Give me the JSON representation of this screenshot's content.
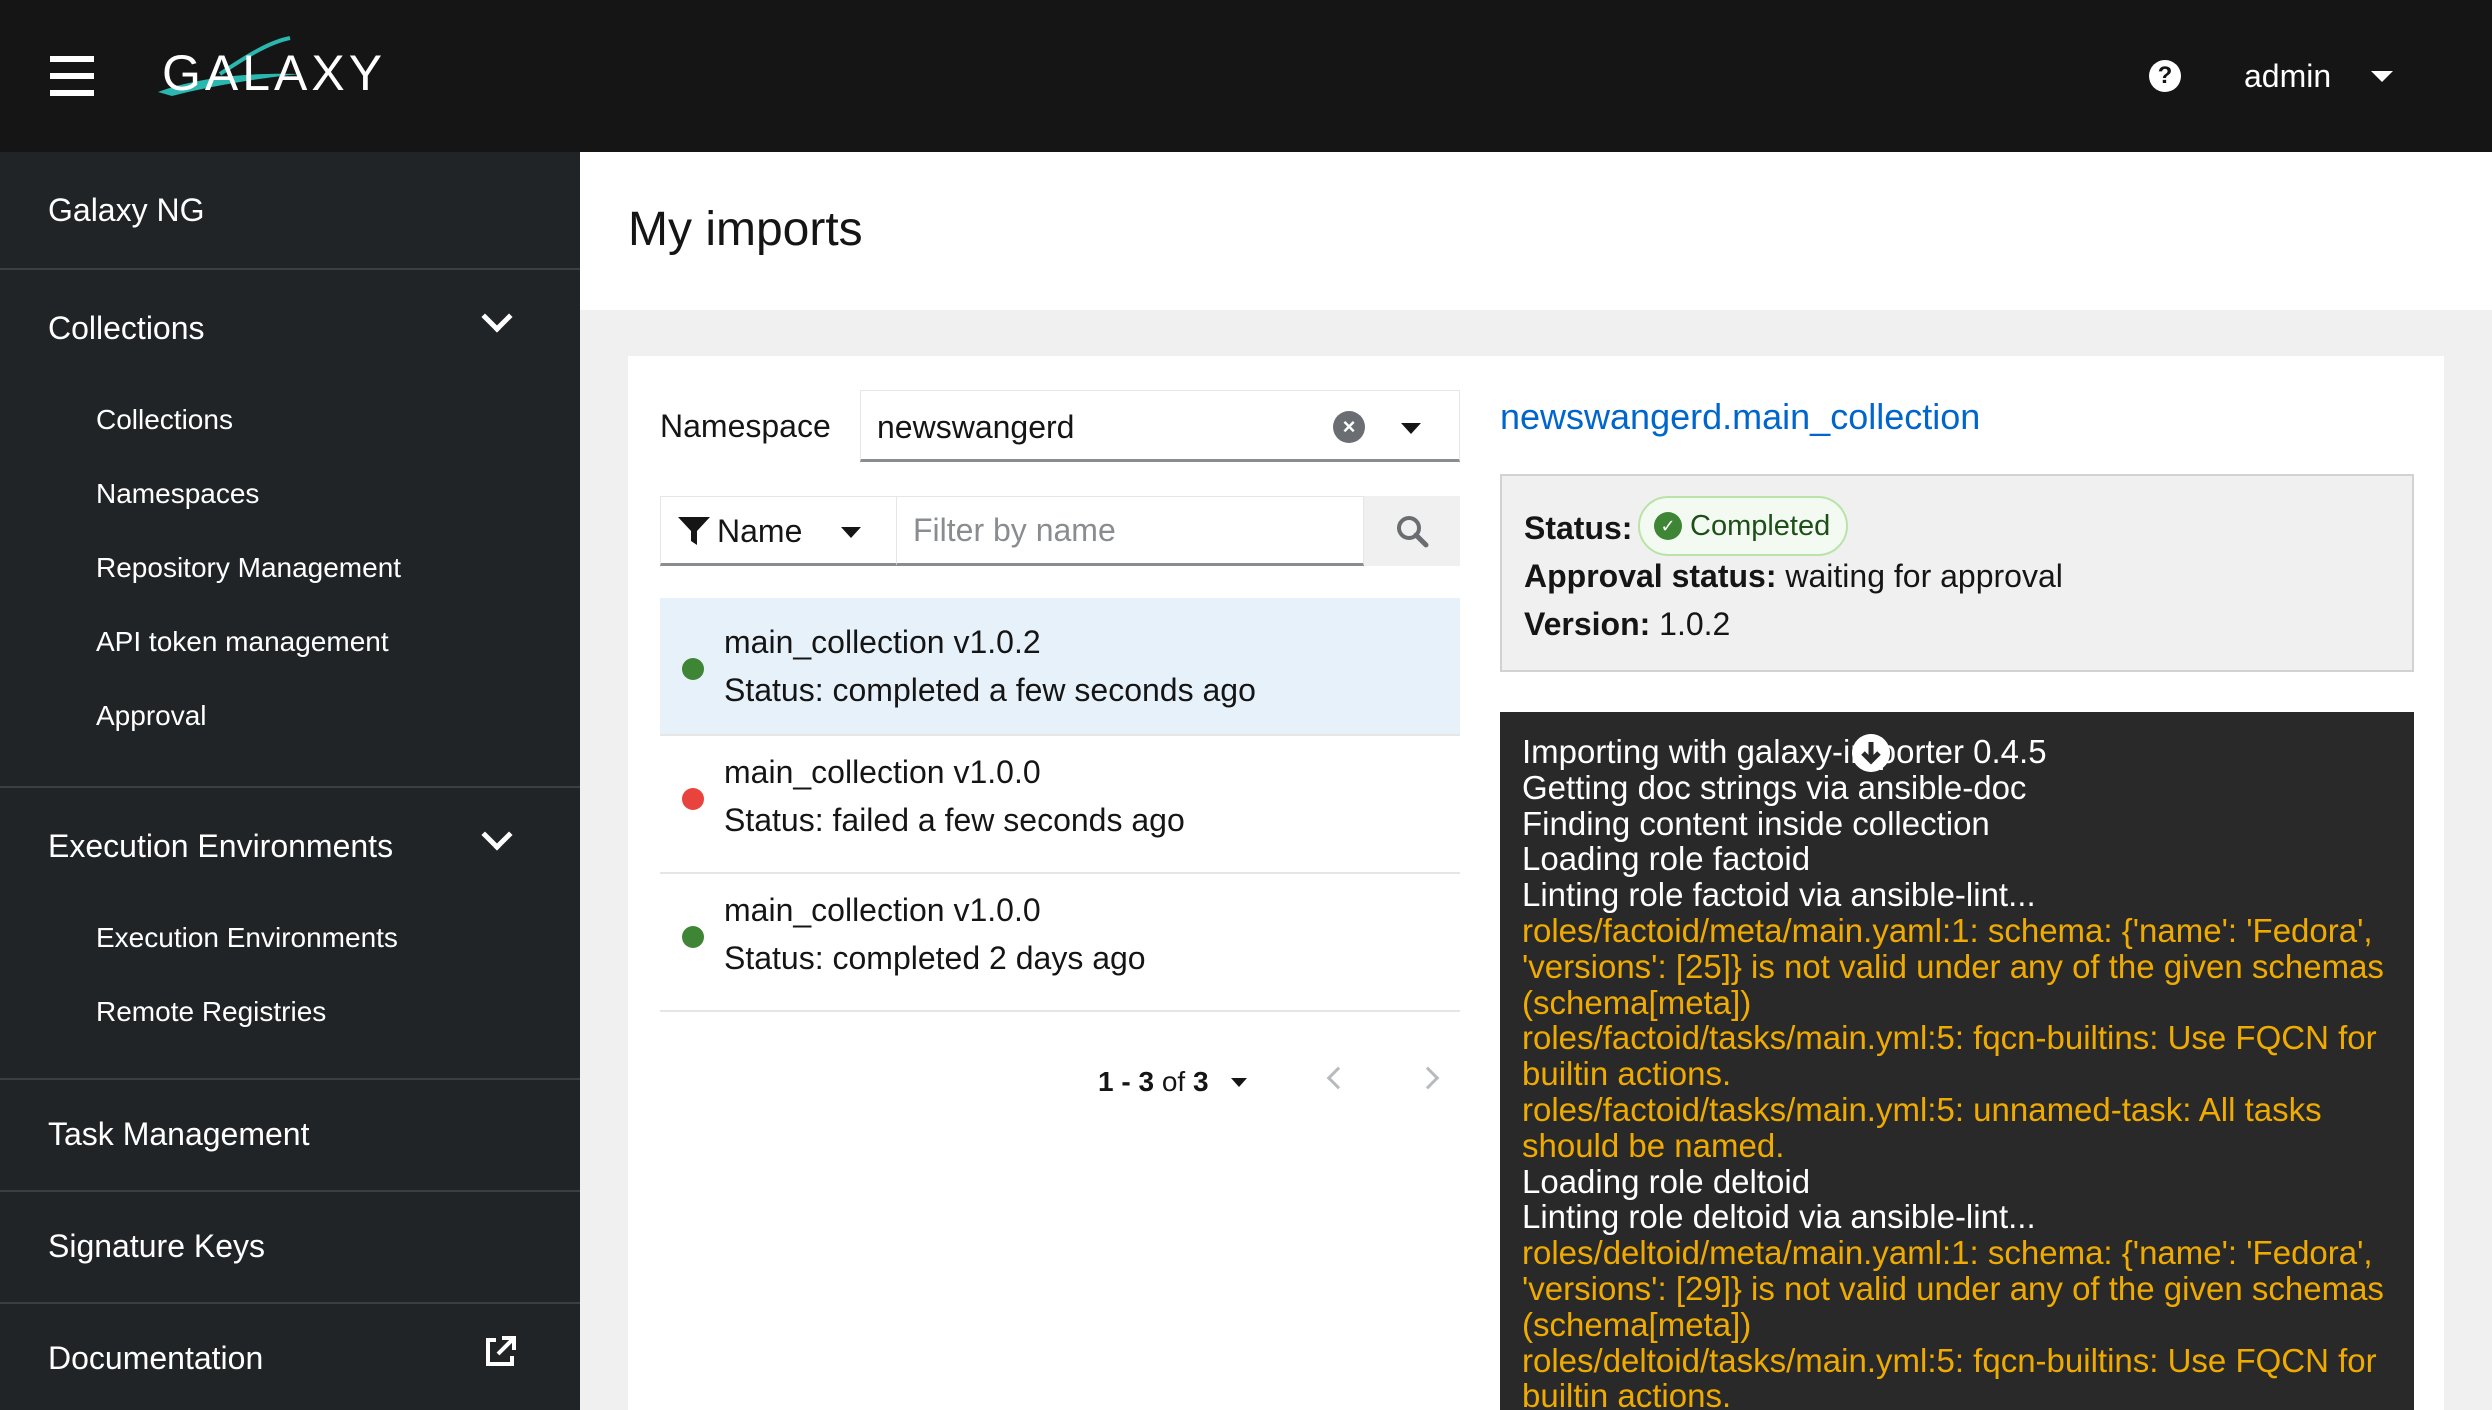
{
  "header": {
    "logo_text": "GALAXY",
    "user": "admin"
  },
  "sidebar": {
    "top_item": "Galaxy NG",
    "sections": [
      {
        "label": "Collections",
        "items": [
          "Collections",
          "Namespaces",
          "Repository Management",
          "API token management",
          "Approval"
        ]
      },
      {
        "label": "Execution Environments",
        "items": [
          "Execution Environments",
          "Remote Registries"
        ]
      }
    ],
    "task_management": "Task Management",
    "signature_keys": "Signature Keys",
    "documentation": "Documentation"
  },
  "page": {
    "title": "My imports"
  },
  "namespace_filter": {
    "label": "Namespace",
    "value": "newswangerd"
  },
  "filter": {
    "attribute": "Name",
    "placeholder": "Filter by name"
  },
  "imports": [
    {
      "name": "main_collection v1.0.2",
      "status": "Status: completed a few seconds ago",
      "state": "completed",
      "dot_color": "#3e8635",
      "selected": true
    },
    {
      "name": "main_collection v1.0.0",
      "status": "Status: failed a few seconds ago",
      "state": "failed",
      "dot_color": "#c9190b",
      "selected": false
    },
    {
      "name": "main_collection v1.0.0",
      "status": "Status: completed 2 days ago",
      "state": "completed",
      "dot_color": "#3e8635",
      "selected": false
    }
  ],
  "pagination": {
    "range": "1 - 3",
    "of_word": "of",
    "total": "3"
  },
  "detail": {
    "title": "newswangerd.main_collection",
    "status_label": "Status:",
    "status_value": "Completed",
    "approval_label": "Approval status:",
    "approval_value": "waiting for approval",
    "version_label": "Version:",
    "version_value": "1.0.2"
  },
  "log": [
    {
      "text": "Importing with galaxy-importer 0.4.5",
      "level": "info"
    },
    {
      "text": "Getting doc strings via ansible-doc",
      "level": "info"
    },
    {
      "text": "Finding content inside collection",
      "level": "info"
    },
    {
      "text": "Loading role factoid",
      "level": "info"
    },
    {
      "text": "Linting role factoid via ansible-lint...",
      "level": "info"
    },
    {
      "text": "roles/factoid/meta/main.yaml:1: schema: {'name': 'Fedora', 'versions': [25]} is not valid under any of the given schemas (schema[meta])",
      "level": "warn"
    },
    {
      "text": "roles/factoid/tasks/main.yml:5: fqcn-builtins: Use FQCN for builtin actions.",
      "level": "warn"
    },
    {
      "text": "roles/factoid/tasks/main.yml:5: unnamed-task: All tasks should be named.",
      "level": "warn"
    },
    {
      "text": "Loading role deltoid",
      "level": "info"
    },
    {
      "text": "Linting role deltoid via ansible-lint...",
      "level": "info"
    },
    {
      "text": "roles/deltoid/meta/main.yaml:1: schema: {'name': 'Fedora', 'versions': [29]} is not valid under any of the given schemas (schema[meta])",
      "level": "warn"
    },
    {
      "text": "roles/deltoid/tasks/main.yml:5: fqcn-builtins: Use FQCN for builtin actions.",
      "level": "warn"
    }
  ],
  "colors": {
    "brand_teal": "#2ab7b0",
    "link": "#0066cc",
    "warn": "#f0ab00",
    "success": "#3e8635",
    "danger": "#c9190b"
  }
}
